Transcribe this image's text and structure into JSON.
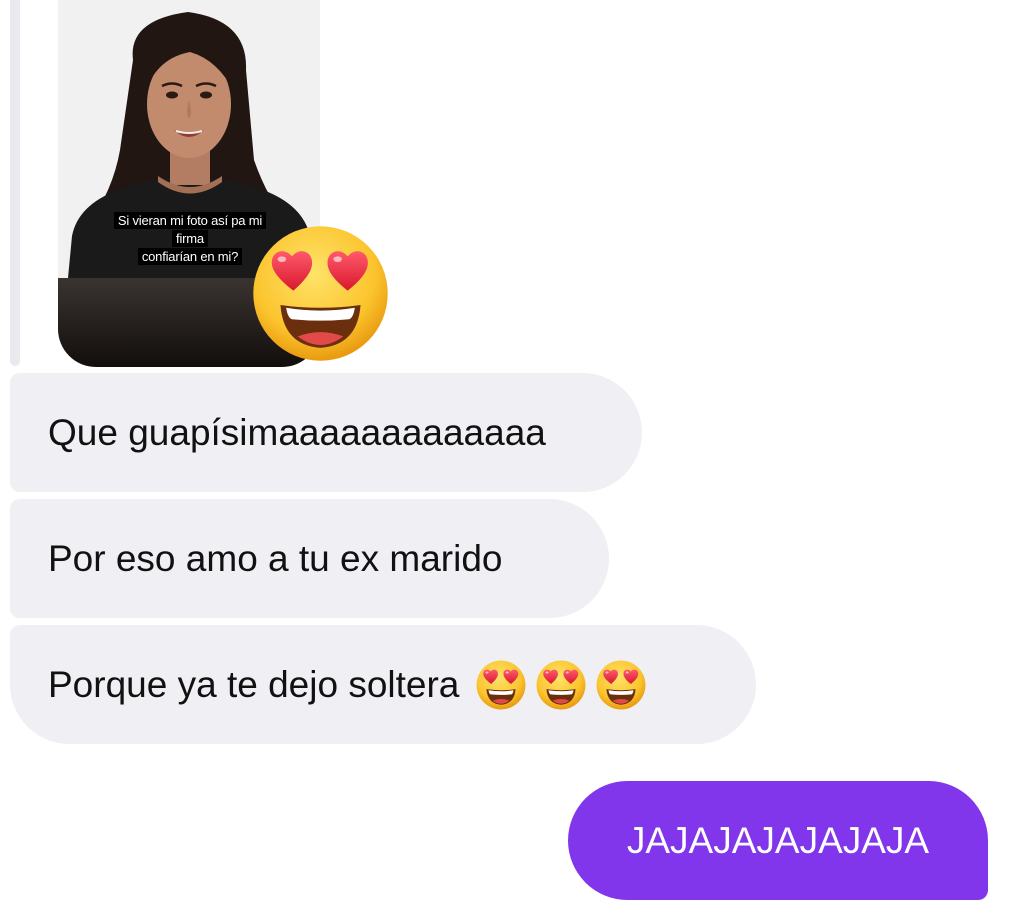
{
  "story_reply": {
    "caption_line1": "Si vieran mi foto así pa mi firma",
    "caption_line2": "confiarían en mi?",
    "reaction_icon": "heart-eyes-emoji"
  },
  "messages": [
    {
      "direction": "incoming",
      "text": "Que guapísimaaaaaaaaaaaaa"
    },
    {
      "direction": "incoming",
      "text": "Por eso amo a tu ex marido"
    },
    {
      "direction": "incoming",
      "text": "Porque ya te dejo soltera",
      "emojis": [
        "heart-eyes-emoji",
        "heart-eyes-emoji",
        "heart-eyes-emoji"
      ]
    },
    {
      "direction": "outgoing",
      "text": "JAJAJAJAJAJAJA"
    }
  ],
  "colors": {
    "incoming_bubble": "#efeff4",
    "outgoing_bubble": "#8236ec",
    "incoming_text": "#111111",
    "outgoing_text": "#ffffff"
  }
}
